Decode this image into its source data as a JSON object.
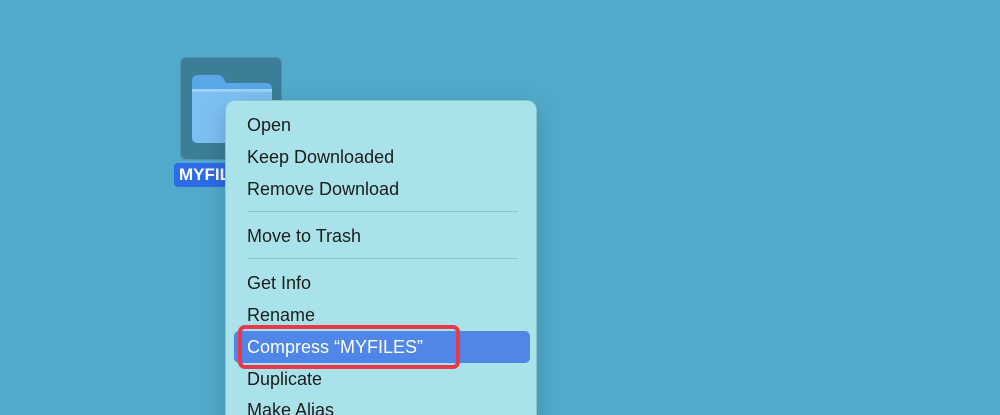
{
  "desktop": {
    "folder": {
      "name": "MYFILES",
      "icon": "folder-icon",
      "selected": true
    }
  },
  "context_menu": {
    "items": [
      {
        "label": "Open"
      },
      {
        "label": "Keep Downloaded"
      },
      {
        "label": "Remove Download"
      },
      {
        "label": "Move to Trash"
      },
      {
        "label": "Get Info"
      },
      {
        "label": "Rename"
      },
      {
        "label": "Compress “MYFILES”",
        "highlighted": true
      },
      {
        "label": "Duplicate"
      },
      {
        "label": "Make Alias"
      }
    ]
  },
  "colors": {
    "desktop_background": "#51aacb",
    "menu_background": "#a9e3e9",
    "highlight": "#4f86e8",
    "selection_label": "#2e6be6",
    "annotation": "#e8394a"
  }
}
